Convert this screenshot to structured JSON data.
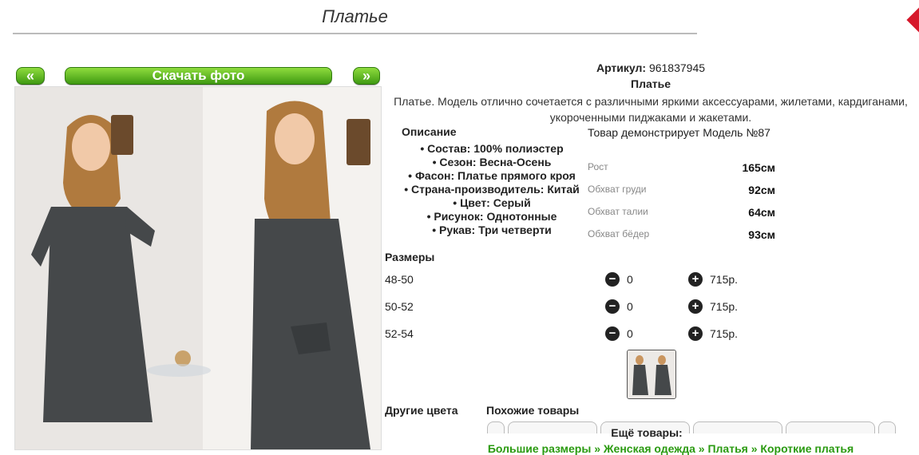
{
  "page_title": "Платье",
  "gallery": {
    "prev_label": "«",
    "download_label": "Скачать фото",
    "next_label": "»"
  },
  "product": {
    "article_label": "Артикул:",
    "article_value": "961837945",
    "name": "Платье",
    "description": "Платье. Модель отлично сочетается с различными яркими аксессуарами, жилетами, кардиганами, укороченными пиджаками и жакетами."
  },
  "details": {
    "title": "Описание",
    "features": [
      "Состав: 100% полиэстер",
      "Сезон: Весна-Осень",
      "Фасон: Платье прямого кроя",
      "Страна-производитель: Китай",
      "Цвет: Серый",
      "Рисунок: Однотонные",
      "Рукав: Три четверти"
    ]
  },
  "model": {
    "title": "Товар демонстрирует Модель №87",
    "params": [
      {
        "label": "Рост",
        "value": "165см"
      },
      {
        "label": "Обхват груди",
        "value": "92см"
      },
      {
        "label": "Обхват талии",
        "value": "64см"
      },
      {
        "label": "Обхват бёдер",
        "value": "93см"
      }
    ]
  },
  "sizes": {
    "title": "Размеры",
    "rows": [
      {
        "size": "48-50",
        "qty": "0",
        "price": "715р."
      },
      {
        "size": "50-52",
        "qty": "0",
        "price": "715р."
      },
      {
        "size": "52-54",
        "qty": "0",
        "price": "715р."
      }
    ]
  },
  "other_colors_title": "Другие цвета",
  "similar_title": "Похожие товары",
  "more_title": "Ещё товары:",
  "categories": {
    "c1": "Большие размеры",
    "c2": "Женская одежда",
    "c3": "Платья",
    "c4": "Короткие платья",
    "sep": "»"
  },
  "colors": {
    "accent_green": "#3f9a12",
    "dress_gray": "#45484a",
    "link_green": "#2a9a10",
    "logo_red": "#d6182b"
  }
}
